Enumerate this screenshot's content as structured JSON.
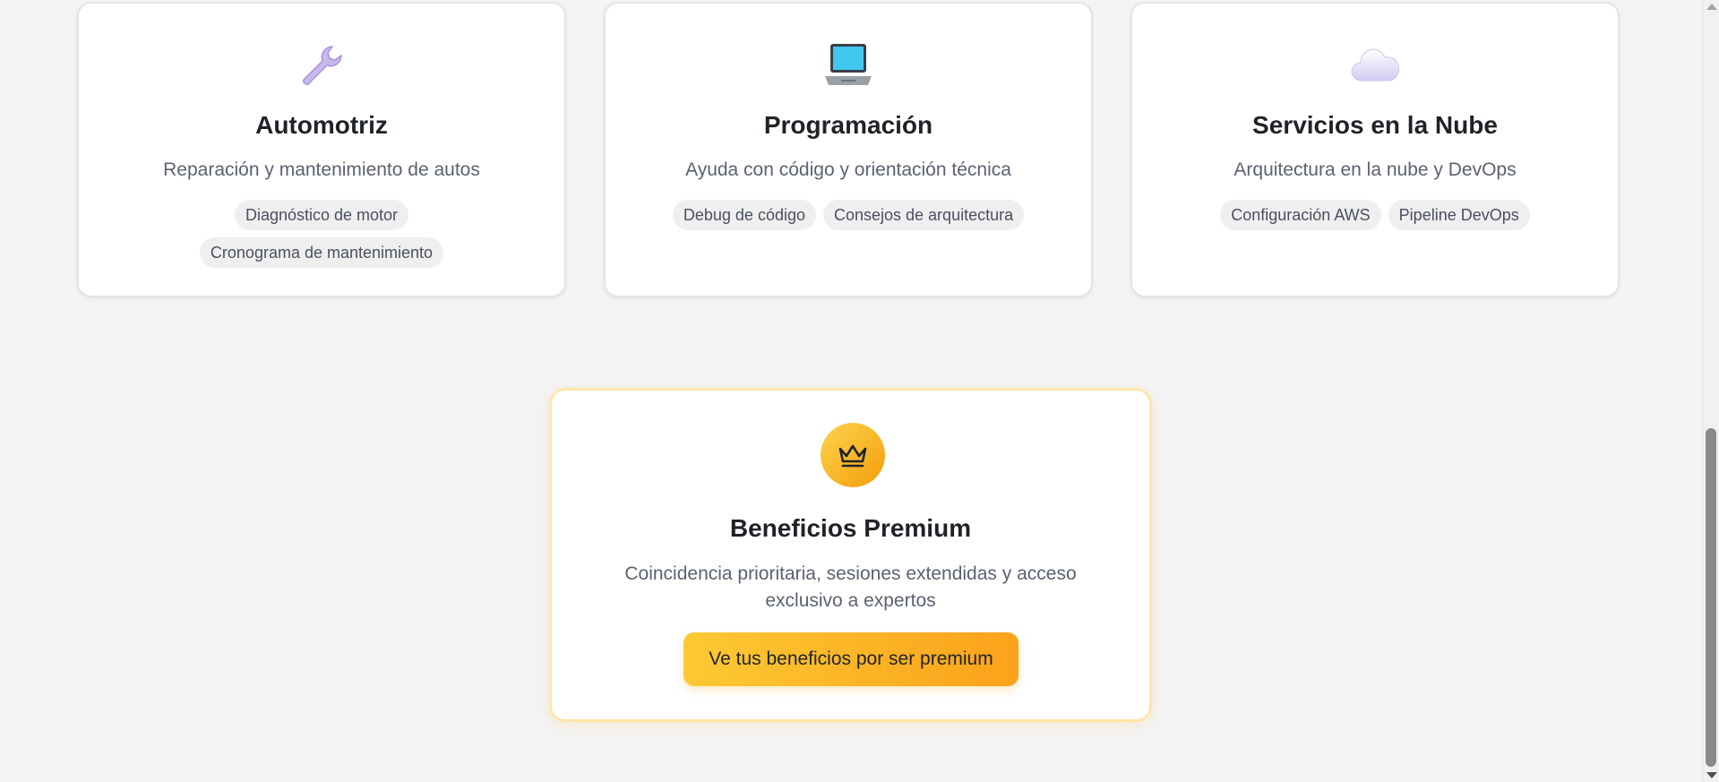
{
  "categories": [
    {
      "icon": "wrench-icon",
      "emoji": "🔧",
      "title": "Automotriz",
      "description": "Reparación y mantenimiento de autos",
      "tags": [
        "Diagnóstico de motor",
        "Cronograma de mantenimiento"
      ]
    },
    {
      "icon": "laptop-icon",
      "emoji": "💻",
      "title": "Programación",
      "description": "Ayuda con código y orientación técnica",
      "tags": [
        "Debug de código",
        "Consejos de arquitectura"
      ]
    },
    {
      "icon": "cloud-icon",
      "emoji": "☁️",
      "title": "Servicios en la Nube",
      "description": "Arquitectura en la nube y DevOps",
      "tags": [
        "Configuración AWS",
        "Pipeline DevOps"
      ]
    }
  ],
  "premium": {
    "icon": "crown-icon",
    "title": "Beneficios Premium",
    "description": "Coincidencia prioritaria, sesiones extendidas y acceso exclusivo a expertos",
    "button_label": "Ve tus beneficios por ser premium"
  },
  "colors": {
    "background": "#f4f4f5",
    "premium_gradient_start": "#fcc934",
    "premium_gradient_end": "#fba21b",
    "premium_border": "#fde7a8"
  }
}
